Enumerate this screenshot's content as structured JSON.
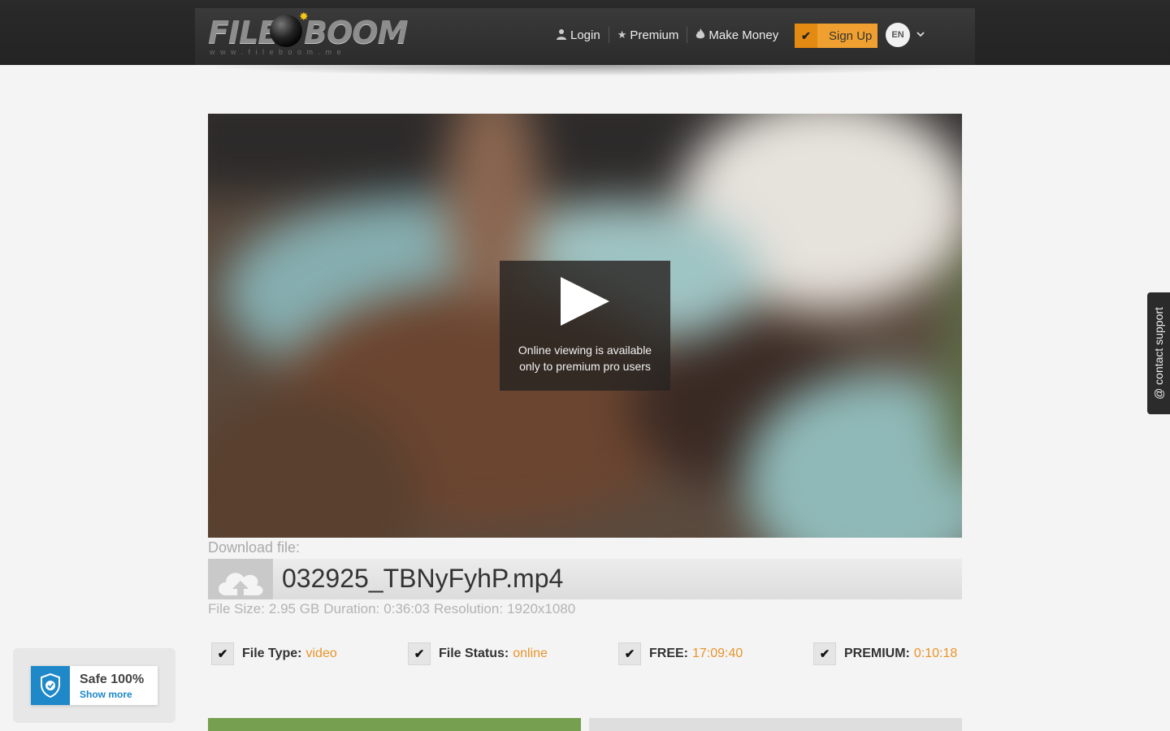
{
  "header": {
    "logo": {
      "word1": "FILE",
      "word2": "BOOM",
      "url": "www.fileboom.me"
    },
    "nav": {
      "login": "Login",
      "premium": "Premium",
      "make_money": "Make Money",
      "signup": "Sign Up",
      "language": "EN"
    }
  },
  "video": {
    "notice_line1": "Online viewing is available",
    "notice_line2": "only to premium pro users"
  },
  "file": {
    "download_label": "Download file:",
    "name": "032925_TBNyFyhP.mp4",
    "size_label": "File Size:",
    "size_value": "2.95 GB",
    "duration_label": "Duration:",
    "duration_value": "0:36:03",
    "resolution_label": "Resolution:",
    "resolution_value": "1920x1080"
  },
  "stats": [
    {
      "label": "File Type:",
      "value": "video"
    },
    {
      "label": "File Status:",
      "value": "online"
    },
    {
      "label": "FREE:",
      "value": "17:09:40"
    },
    {
      "label": "PREMIUM:",
      "value": "0:10:18"
    }
  ],
  "safe_badge": {
    "title": "Safe 100%",
    "link": "Show more"
  },
  "support_tab": {
    "label": "@ contact support"
  },
  "colors": {
    "accent_orange": "#e8942a",
    "signup_bg": "#f0a030",
    "free_button": "#76a050",
    "shield_blue": "#1e88c8"
  },
  "icons": {
    "login": "user-icon",
    "premium": "star-icon",
    "make_money": "flame-icon",
    "signup": "check-icon",
    "language": "chevron-down-icon",
    "play": "play-icon",
    "upload": "cloud-upload-icon",
    "safe": "shield-check-icon"
  }
}
